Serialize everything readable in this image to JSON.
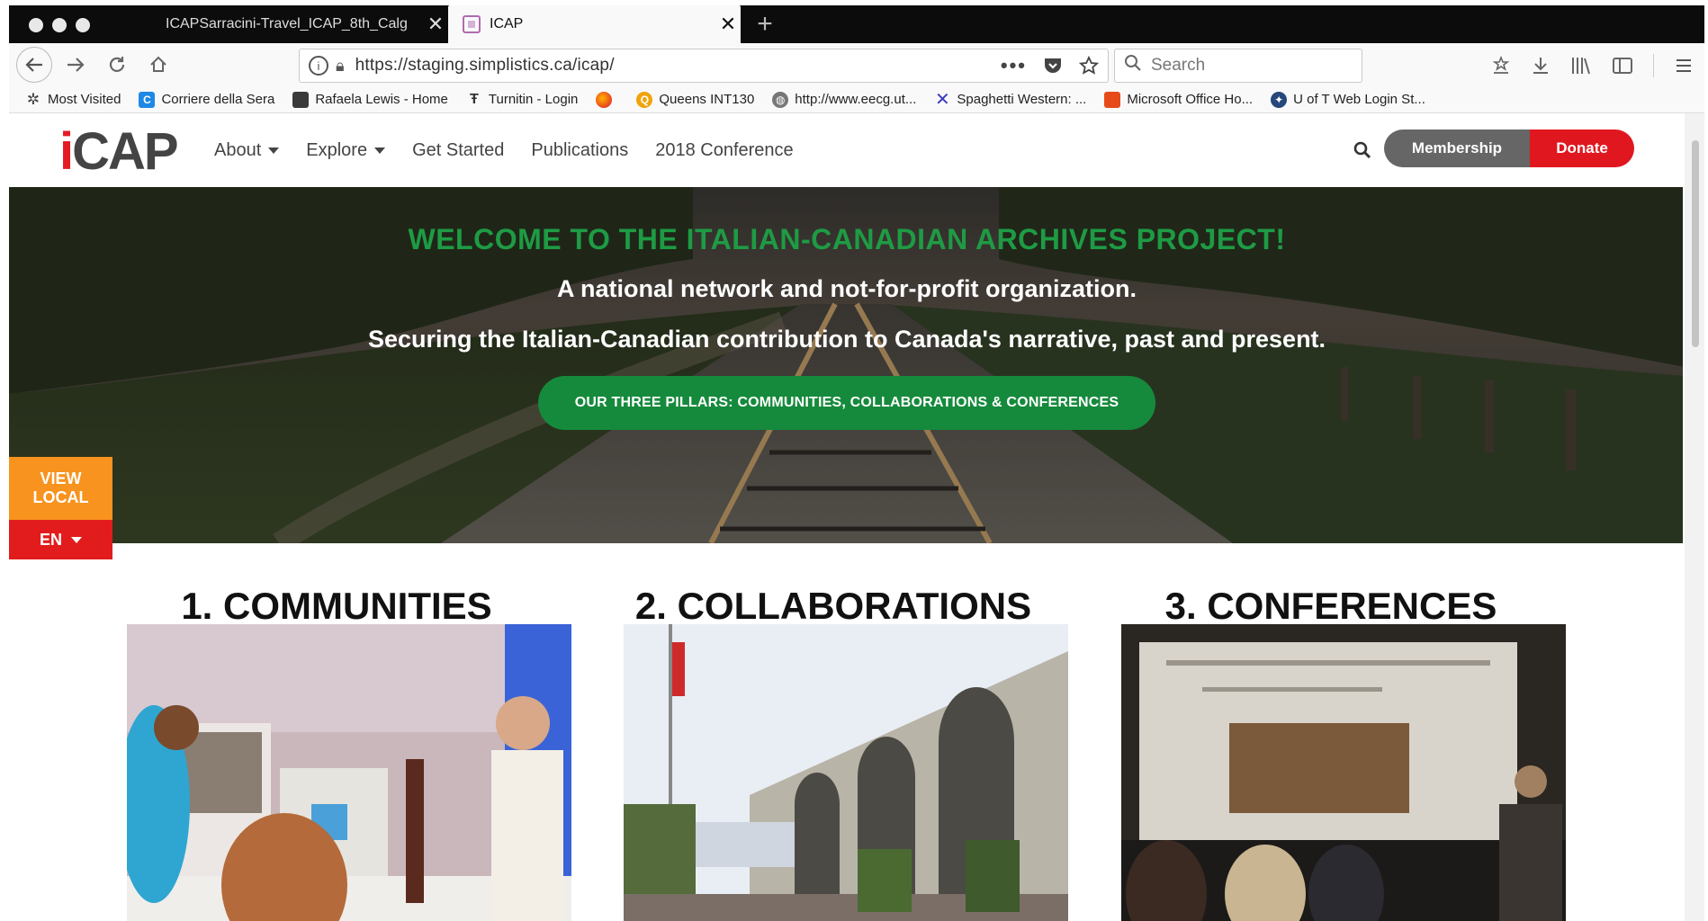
{
  "browser": {
    "tabs": [
      {
        "title": "ICAPSarracini-Travel_ICAP_8th_Calg",
        "active": false
      },
      {
        "title": "ICAP",
        "active": true
      }
    ],
    "url": "https://staging.simplistics.ca/icap/",
    "search_placeholder": "Search",
    "bookmarks": [
      {
        "label": "Most Visited",
        "icon": "gear-icon"
      },
      {
        "label": "Corriere della Sera",
        "icon": "corriere-icon"
      },
      {
        "label": "Rafaela Lewis - Home",
        "icon": "box-icon"
      },
      {
        "label": "Turnitin - Login",
        "icon": "turnitin-icon"
      },
      {
        "label": "",
        "icon": "firefox-icon"
      },
      {
        "label": "Queens INT130",
        "icon": "queens-icon"
      },
      {
        "label": "http://www.eecg.ut...",
        "icon": "globe-icon"
      },
      {
        "label": "Spaghetti Western: ...",
        "icon": "x-logo-icon"
      },
      {
        "label": "Microsoft Office Ho...",
        "icon": "office-icon"
      },
      {
        "label": "U of T Web Login St...",
        "icon": "uoft-icon"
      }
    ]
  },
  "site": {
    "logo": {
      "accent": "i",
      "rest": "CAP"
    },
    "nav": [
      {
        "label": "About",
        "dropdown": true
      },
      {
        "label": "Explore",
        "dropdown": true
      },
      {
        "label": "Get Started",
        "dropdown": false
      },
      {
        "label": "Publications",
        "dropdown": false
      },
      {
        "label": "2018 Conference",
        "dropdown": false
      }
    ],
    "membership_label": "Membership",
    "donate_label": "Donate",
    "hero": {
      "title": "WELCOME TO THE ITALIAN-CANADIAN ARCHIVES PROJECT!",
      "subtitle_1": "A national network and not-for-profit organization.",
      "subtitle_2": "Securing the Italian-Canadian contribution to Canada's narrative, past and present.",
      "button": "OUR THREE PILLARS: COMMUNITIES, COLLABORATIONS & CONFERENCES"
    },
    "view_local": {
      "line1": "VIEW",
      "line2": "LOCAL"
    },
    "language": "EN",
    "pillars": [
      {
        "title": "1. COMMUNITIES"
      },
      {
        "title": "2. COLLABORATIONS"
      },
      {
        "title": "3. CONFERENCES"
      }
    ],
    "colors": {
      "brand_red": "#e0171f",
      "hero_green": "#1e9b44",
      "button_green": "#168a3c",
      "view_local_orange": "#f7931e",
      "membership_gray": "#666666"
    }
  }
}
